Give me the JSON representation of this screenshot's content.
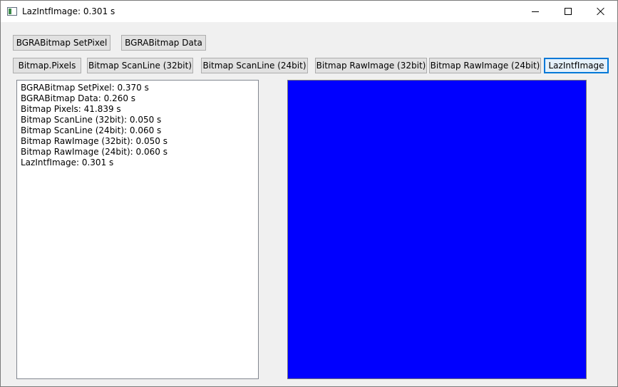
{
  "window": {
    "title": "LazIntfImage: 0.301 s",
    "app_icon": "app-window-icon",
    "caption_icons": [
      "minimize-icon",
      "maximize-icon",
      "close-icon"
    ]
  },
  "buttons": {
    "row1": [
      {
        "label": "BGRABitmap SetPixel"
      },
      {
        "label": "BGRABitmap Data"
      }
    ],
    "row2": [
      {
        "label": "Bitmap.Pixels"
      },
      {
        "label": "Bitmap ScanLine (32bit)"
      },
      {
        "label": "Bitmap ScanLine (24bit)"
      },
      {
        "label": "Bitmap RawImage (32bit)"
      },
      {
        "label": "Bitmap RawImage (24bit)"
      },
      {
        "label": "LazIntfImage"
      }
    ]
  },
  "results_memo": {
    "lines": [
      "BGRABitmap SetPixel: 0.370 s",
      "BGRABitmap Data: 0.260 s",
      "Bitmap Pixels: 41.839 s",
      "Bitmap ScanLine (32bit): 0.050 s",
      "Bitmap ScanLine (24bit): 0.060 s",
      "Bitmap RawImage (32bit): 0.050 s",
      "Bitmap RawImage (24bit): 0.060 s",
      "LazIntfImage: 0.301 s"
    ]
  },
  "image_preview": {
    "fill_color": "#0000ff"
  },
  "colors": {
    "focus_accent": "#0078d7",
    "window_bg": "#f0f0f0"
  }
}
